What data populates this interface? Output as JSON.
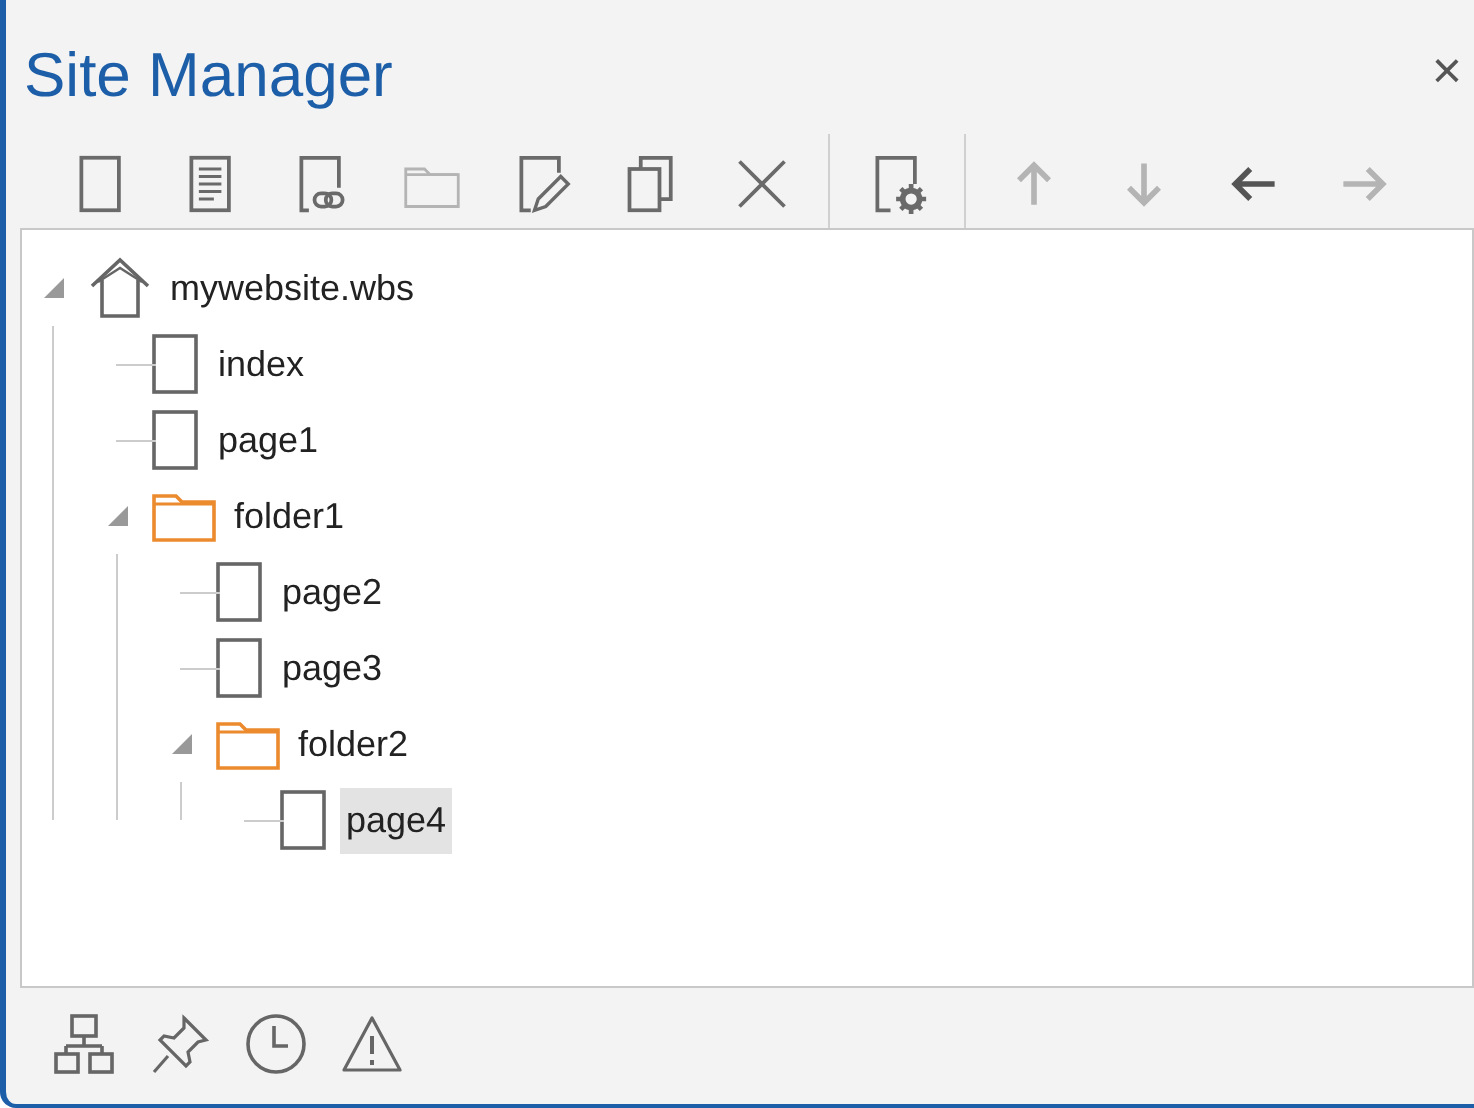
{
  "window": {
    "title": "Site Manager",
    "close": "×"
  },
  "toolbar_groups": [
    [
      {
        "kind": "new-page",
        "disabled": false
      },
      {
        "kind": "text-page",
        "disabled": false
      },
      {
        "kind": "link-page",
        "disabled": false
      },
      {
        "kind": "folder",
        "disabled": true
      },
      {
        "kind": "edit",
        "disabled": false
      },
      {
        "kind": "copy",
        "disabled": false
      },
      {
        "kind": "delete",
        "disabled": false
      }
    ],
    [
      {
        "kind": "page-settings",
        "disabled": false
      }
    ],
    [
      {
        "kind": "up",
        "disabled": true
      },
      {
        "kind": "down",
        "disabled": true
      },
      {
        "kind": "left",
        "disabled": false
      },
      {
        "kind": "right",
        "disabled": true
      }
    ]
  ],
  "tree": [
    {
      "label": "mywebsite.wbs",
      "kind": "site",
      "expanded": true,
      "selected": false,
      "children": [
        {
          "label": "index",
          "kind": "page",
          "selected": false
        },
        {
          "label": "page1",
          "kind": "page",
          "selected": false
        },
        {
          "label": "folder1",
          "kind": "folder",
          "expanded": true,
          "selected": false,
          "children": [
            {
              "label": "page2",
              "kind": "page",
              "selected": false
            },
            {
              "label": "page3",
              "kind": "page",
              "selected": false
            },
            {
              "label": "folder2",
              "kind": "folder",
              "expanded": true,
              "selected": false,
              "children": [
                {
                  "label": "page4",
                  "kind": "page",
                  "selected": true
                }
              ]
            }
          ]
        }
      ]
    }
  ],
  "bottom_toolbar": [
    {
      "kind": "sitemap"
    },
    {
      "kind": "pin"
    },
    {
      "kind": "clock"
    },
    {
      "kind": "warning"
    }
  ]
}
